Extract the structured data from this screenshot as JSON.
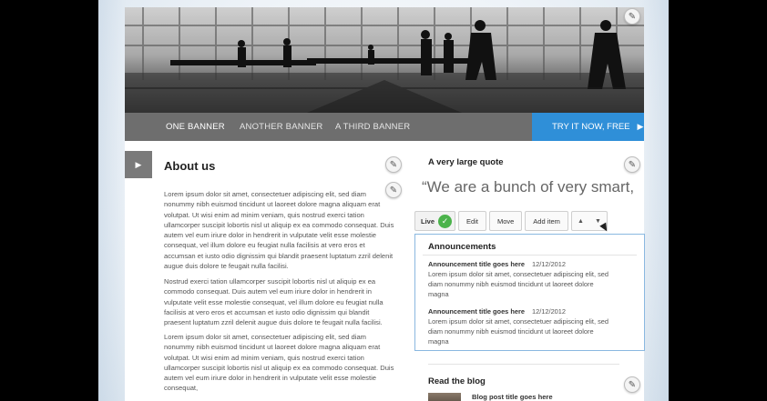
{
  "nav": {
    "items": [
      "ONE BANNER",
      "ANOTHER BANNER",
      "A THIRD BANNER"
    ],
    "cta_label": "TRY IT NOW, FREE",
    "cta_arrow": "▶"
  },
  "about": {
    "tab_icon": "▶",
    "title": "About us",
    "paragraphs": [
      "Lorem ipsum dolor sit amet, consectetuer adipiscing elit, sed diam nonummy nibh euismod tincidunt ut laoreet dolore magna aliquam erat volutpat. Ut wisi enim ad minim veniam, quis nostrud exerci tation ullamcorper suscipit lobortis nisl ut aliquip ex ea commodo consequat. Duis autem vel eum iriure dolor in hendrerit in vulputate velit esse molestie consequat, vel illum dolore eu feugiat nulla facilisis at vero eros et accumsan et iusto odio dignissim qui blandit praesent luptatum zzril delenit augue duis dolore te feugait nulla facilisi.",
      "Nostrud exerci tation ullamcorper suscipit lobortis nisl ut aliquip ex ea commodo consequat. Duis autem vel eum iriure dolor in hendrerit in vulputate velit esse molestie consequat, vel illum dolore eu feugiat nulla facilisis at vero eros et accumsan et iusto odio dignissim qui blandit praesent luptatum zzril delenit augue duis dolore te feugait nulla facilisi.",
      "Lorem ipsum dolor sit amet, consectetuer adipiscing elit, sed diam nonummy nibh euismod tincidunt ut laoreet dolore magna aliquam erat volutpat. Ut wisi enim ad minim veniam, quis nostrud exerci tation ullamcorper suscipit lobortis nisl ut aliquip ex ea commodo consequat. Duis autem vel eum iriure dolor in hendrerit in vulputate velit esse molestie consequat,"
    ]
  },
  "quote": {
    "title": "A very large quote",
    "text": "“We are a bunch of very smart, cool individuals”"
  },
  "toolbar": {
    "live_label": "Live",
    "check_icon": "✓",
    "edit_label": "Edit",
    "move_label": "Move",
    "add_item_label": "Add item",
    "up_icon": "▲",
    "down_icon": "▼"
  },
  "announcements": {
    "title": "Announcements",
    "items": [
      {
        "title": "Announcement title goes here",
        "date": "12/12/2012",
        "body": "Lorem ipsum dolor sit amet, consectetuer adipiscing elit, sed diam nonummy nibh euismod tincidunt ut laoreet dolore magna"
      },
      {
        "title": "Announcement title goes here",
        "date": "12/12/2012",
        "body": "Lorem ipsum dolor sit amet, consectetuer adipiscing elit, sed diam nonummy nibh euismod tincidunt ut laoreet dolore magna"
      }
    ]
  },
  "blog": {
    "title": "Read the blog",
    "post_title": "Blog post title goes here"
  },
  "icons": {
    "pencil": "✎"
  },
  "colors": {
    "nav_bg": "#6e6e6e",
    "cta_bg": "#2f8fd8",
    "live_check": "#4bb34b",
    "selection_border": "#8ab8e0"
  }
}
